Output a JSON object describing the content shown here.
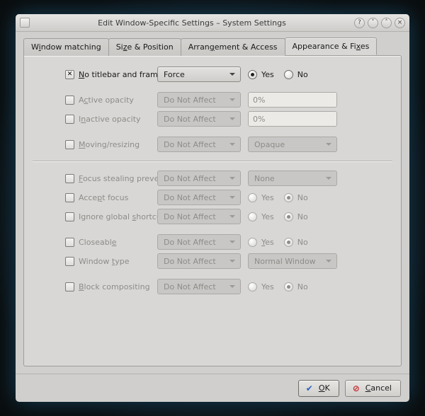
{
  "titlebar": {
    "title": "Edit Window-Specific Settings – System Settings"
  },
  "tabs": {
    "t0_pre": "W",
    "t0_u": "i",
    "t0_post": "ndow matching",
    "t1_pre": "Si",
    "t1_u": "z",
    "t1_post": "e & Position",
    "t2_pre": "Arran",
    "t2_u": "g",
    "t2_post": "ement & Access",
    "t3_pre": "Appearance & Fi",
    "t3_u": "x",
    "t3_post": "es"
  },
  "rows": {
    "notitlebar": {
      "pre": "",
      "u": "N",
      "post": "o titlebar and frame",
      "mode": "Force",
      "yes": "Yes",
      "no": "No"
    },
    "activeop": {
      "pre": "A",
      "u": "c",
      "post": "tive opacity",
      "mode": "Do Not Affect",
      "val": "0%"
    },
    "inactiveop": {
      "pre": "I",
      "u": "n",
      "post": "active opacity",
      "mode": "Do Not Affect",
      "val": "0%"
    },
    "moving": {
      "pre": "",
      "u": "M",
      "post": "oving/resizing",
      "mode": "Do Not Affect",
      "combo": "Opaque"
    },
    "focussteal": {
      "pre": "",
      "u": "F",
      "post": "ocus stealing prevention",
      "mode": "Do Not Affect",
      "combo": "None"
    },
    "acceptf": {
      "pre": "Acce",
      "u": "p",
      "post": "t focus",
      "mode": "Do Not Affect",
      "yes": "Yes",
      "no": "No"
    },
    "ignoresh": {
      "pre": "Ignore global ",
      "u": "s",
      "post": "hortcuts",
      "mode": "Do Not Affect",
      "yes": "Yes",
      "no": "No"
    },
    "closeable": {
      "pre": "Closeabl",
      "u": "e",
      "post": "",
      "mode": "Do Not Affect",
      "yes": "Yes",
      "no": "No"
    },
    "wintype": {
      "pre": "Window ",
      "u": "t",
      "post": "ype",
      "mode": "Do Not Affect",
      "combo": "Normal Window"
    },
    "blockcomp": {
      "pre": "",
      "u": "B",
      "post": "lock compositing",
      "mode": "Do Not Affect",
      "yes": "Yes",
      "no": "No"
    }
  },
  "footer": {
    "ok_u": "O",
    "ok_post": "K",
    "cancel_u": "C",
    "cancel_post": "ancel"
  }
}
